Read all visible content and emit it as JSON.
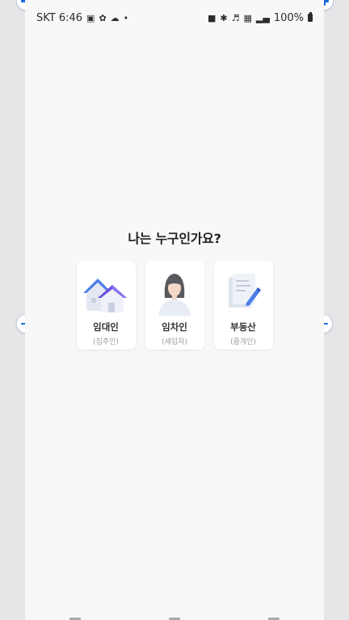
{
  "status_bar": {
    "carrier_time": "SKT 6:46",
    "battery": "100%",
    "left_icons": [
      "gallery-icon",
      "pinwheel-icon",
      "cloud-icon",
      "dot-icon"
    ],
    "right_icons": [
      "alarm-icon",
      "bluetooth-icon",
      "mute-icon",
      "volte-icon",
      "signal-icon"
    ]
  },
  "main": {
    "title": "나는 누구인가요?",
    "cards": [
      {
        "label": "임대인",
        "sub": "(집주인)",
        "icon": "house-icon"
      },
      {
        "label": "임차인",
        "sub": "(세입자)",
        "icon": "person-icon"
      },
      {
        "label": "부동산",
        "sub": "(중개인)",
        "icon": "document-pen-icon"
      }
    ]
  },
  "colors": {
    "accent": "#1769e0",
    "background": "#f8f8f9",
    "card": "#ffffff"
  }
}
